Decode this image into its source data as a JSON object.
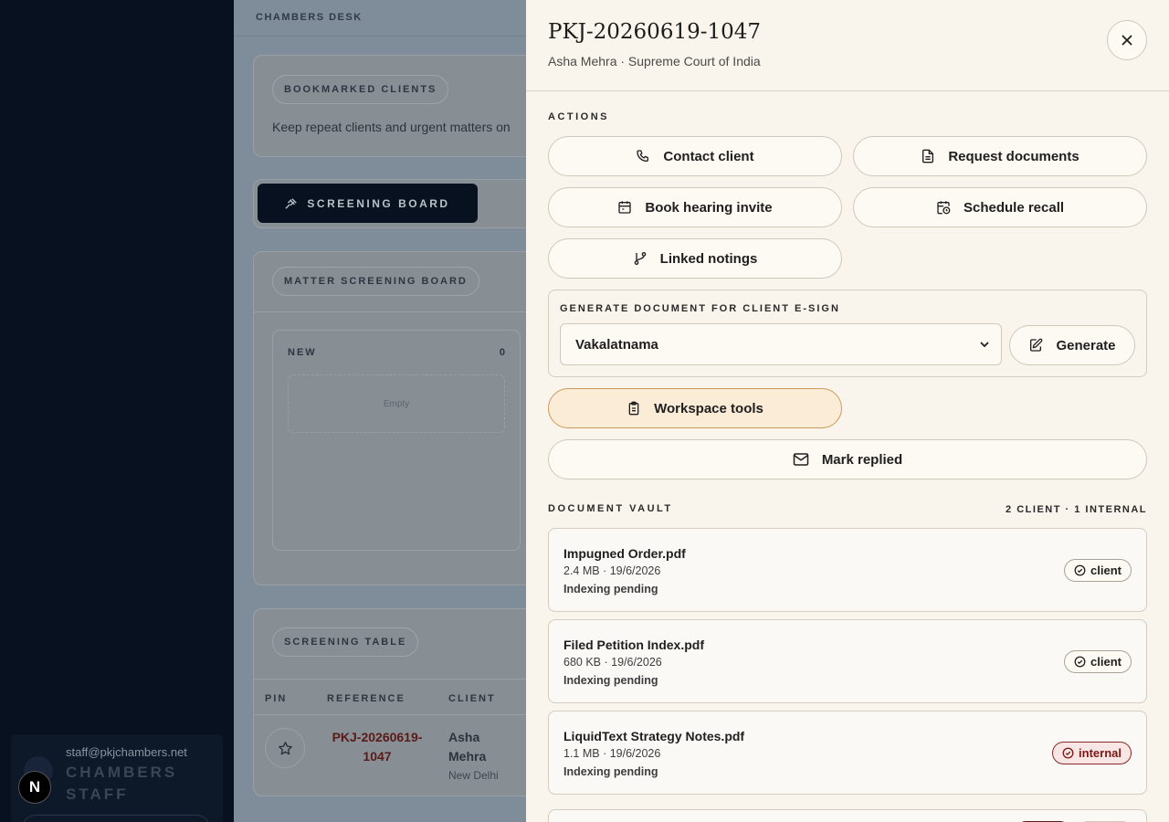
{
  "sidebar": {
    "user_email": "staff@pkjchambers.net",
    "user_role": "CHAMBERS STAFF",
    "badge": "N"
  },
  "main": {
    "topbar_title": "CHAMBERS DESK",
    "bookmarked": {
      "title": "BOOKMARKED CLIENTS",
      "text": "Keep repeat clients and urgent matters on"
    },
    "board_button": "SCREENING BOARD",
    "board": {
      "title": "MATTER SCREENING BOARD",
      "column_title": "NEW",
      "column_count": "0",
      "empty_text": "Empty"
    },
    "table": {
      "title": "SCREENING TABLE",
      "headers": [
        "PIN",
        "REFERENCE",
        "CLIENT"
      ],
      "row": {
        "reference": "PKJ-20260619-1047",
        "client": "Asha Mehra",
        "location": "New Delhi"
      }
    }
  },
  "drawer": {
    "title": "PKJ-20260619-1047",
    "subtitle": "Asha Mehra · Supreme Court of India",
    "actions_label": "ACTIONS",
    "actions": {
      "contact": "Contact client",
      "request_docs": "Request documents",
      "book_hearing": "Book hearing invite",
      "schedule_recall": "Schedule recall",
      "linked_notings": "Linked notings"
    },
    "generate": {
      "label": "GENERATE DOCUMENT FOR CLIENT E-SIGN",
      "selected": "Vakalatnama",
      "button": "Generate"
    },
    "workspace_tools": "Workspace tools",
    "mark_replied": "Mark replied",
    "vault": {
      "label": "DOCUMENT VAULT",
      "count": "2 CLIENT · 1 INTERNAL",
      "docs": [
        {
          "name": "Impugned Order.pdf",
          "meta": "2.4 MB · 19/6/2026",
          "status": "Indexing pending",
          "tag": "client"
        },
        {
          "name": "Filed Petition Index.pdf",
          "meta": "680 KB · 19/6/2026",
          "status": "Indexing pending",
          "tag": "client"
        },
        {
          "name": "LiquidText Strategy Notes.pdf",
          "meta": "1.1 MB · 19/6/2026",
          "status": "Indexing pending",
          "tag": "internal"
        }
      ]
    }
  },
  "colors": {
    "overlay": "#7f8d9b",
    "sidebar": "#07111f",
    "drawer": "#faf5ec",
    "internal_tag": "#7a1717"
  }
}
